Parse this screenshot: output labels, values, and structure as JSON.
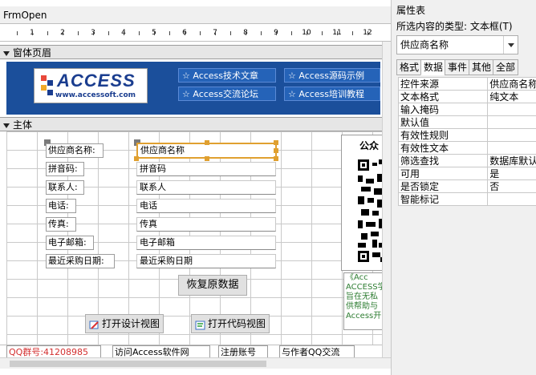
{
  "form": {
    "title": "FrmOpen",
    "ruler_marks": [
      "1",
      "2",
      "3",
      "4",
      "5",
      "6",
      "7",
      "8",
      "9",
      "10",
      "11",
      "12"
    ],
    "header_section": "窗体页眉",
    "detail_section": "主体",
    "logo": {
      "word": "ACCESS",
      "url": "www.accessoft.com"
    },
    "header_links": [
      "☆ Access技术文章",
      "☆ Access源码示例",
      "☆ Access交流论坛",
      "☆ Access培训教程"
    ],
    "fields": [
      {
        "label": "供应商名称:",
        "value": "供应商名称"
      },
      {
        "label": "拼音码:",
        "value": "拼音码"
      },
      {
        "label": "联系人:",
        "value": "联系人"
      },
      {
        "label": "电话:",
        "value": "电话"
      },
      {
        "label": "传真:",
        "value": "传真"
      },
      {
        "label": "电子邮箱:",
        "value": "电子邮箱"
      },
      {
        "label": "最近采购日期:",
        "value": "最近采购日期"
      }
    ],
    "restore_button": "恢复原数据",
    "design_view_button": "打开设计视图",
    "code_view_button": "打开代码视图",
    "qr_caption": "公众",
    "promo_lines": [
      "《Acc",
      "ACCESS学",
      "旨在无私",
      "供帮助与",
      "Access开"
    ],
    "bottom_items": [
      "QQ群号:41208985",
      "访问Access软件网",
      "注册账号",
      "与作者QQ交流"
    ]
  },
  "property_sheet": {
    "title": "属性表",
    "selection_type": "所选内容的类型: 文本框(T)",
    "selected_object": "供应商名称",
    "tabs": [
      "格式",
      "数据",
      "事件",
      "其他",
      "全部"
    ],
    "active_tab": "数据",
    "rows": [
      {
        "name": "控件来源",
        "value": "供应商名称"
      },
      {
        "name": "文本格式",
        "value": "纯文本"
      },
      {
        "name": "输入掩码",
        "value": ""
      },
      {
        "name": "默认值",
        "value": ""
      },
      {
        "name": "有效性规则",
        "value": ""
      },
      {
        "name": "有效性文本",
        "value": ""
      },
      {
        "name": "筛选查找",
        "value": "数据库默认"
      },
      {
        "name": "可用",
        "value": "是"
      },
      {
        "name": "是否锁定",
        "value": "否"
      },
      {
        "name": "智能标记",
        "value": ""
      }
    ]
  },
  "colors": {
    "header_band": "#1b4f9b",
    "selection": "#e0a030",
    "promo_text": "#2e7d32"
  }
}
